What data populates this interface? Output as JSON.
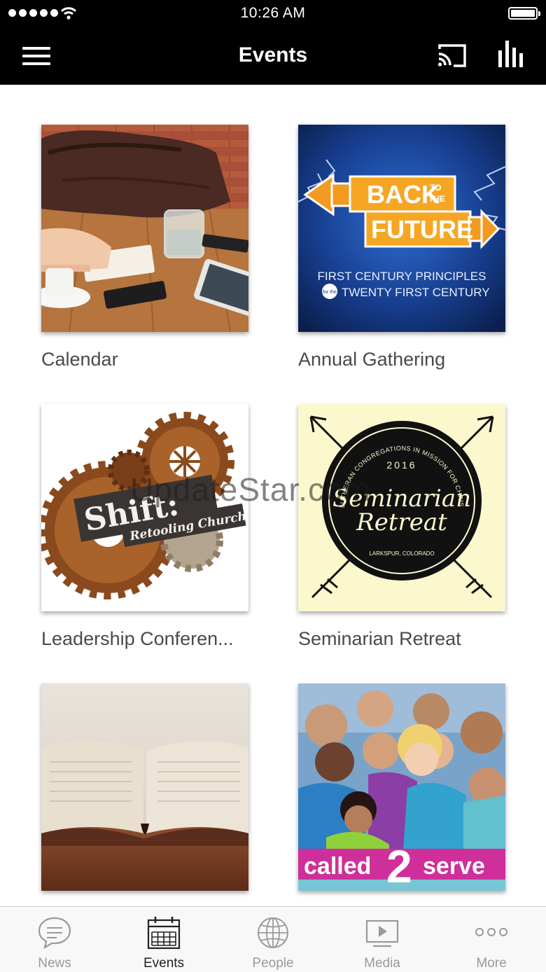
{
  "status_bar": {
    "time": "10:26 AM"
  },
  "nav": {
    "title": "Events"
  },
  "events": [
    {
      "caption": "Calendar"
    },
    {
      "caption": "Annual Gathering",
      "poster": {
        "line1": "BACK",
        "small1": "TO",
        "small2": "THE",
        "line2": "FUTURE",
        "sub1": "FIRST CENTURY PRINCIPLES",
        "sub2": "TWENTY FIRST CENTURY",
        "badge": "for the"
      }
    },
    {
      "caption": "Leadership Conferen...",
      "poster": {
        "title": "Shift:",
        "subtitle": "Retooling Church"
      }
    },
    {
      "caption": "Seminarian Retreat",
      "poster": {
        "arc": "LUTHERAN CONGREGATIONS IN MISSION FOR CHRIST",
        "year": "2016",
        "line1": "Seminarian",
        "line2": "Retreat",
        "place": "LARKSPUR, COLORADO"
      }
    },
    {
      "caption": ""
    },
    {
      "caption": "",
      "poster": {
        "word1": "called",
        "num": "2",
        "word2": "serve"
      }
    }
  ],
  "watermark": "UpdateStar.com",
  "tabs": [
    {
      "label": "News",
      "icon": "chat-bubble-icon"
    },
    {
      "label": "Events",
      "icon": "calendar-icon",
      "active": true
    },
    {
      "label": "People",
      "icon": "globe-icon"
    },
    {
      "label": "Media",
      "icon": "play-video-icon"
    },
    {
      "label": "More",
      "icon": "more-dots-icon"
    }
  ]
}
